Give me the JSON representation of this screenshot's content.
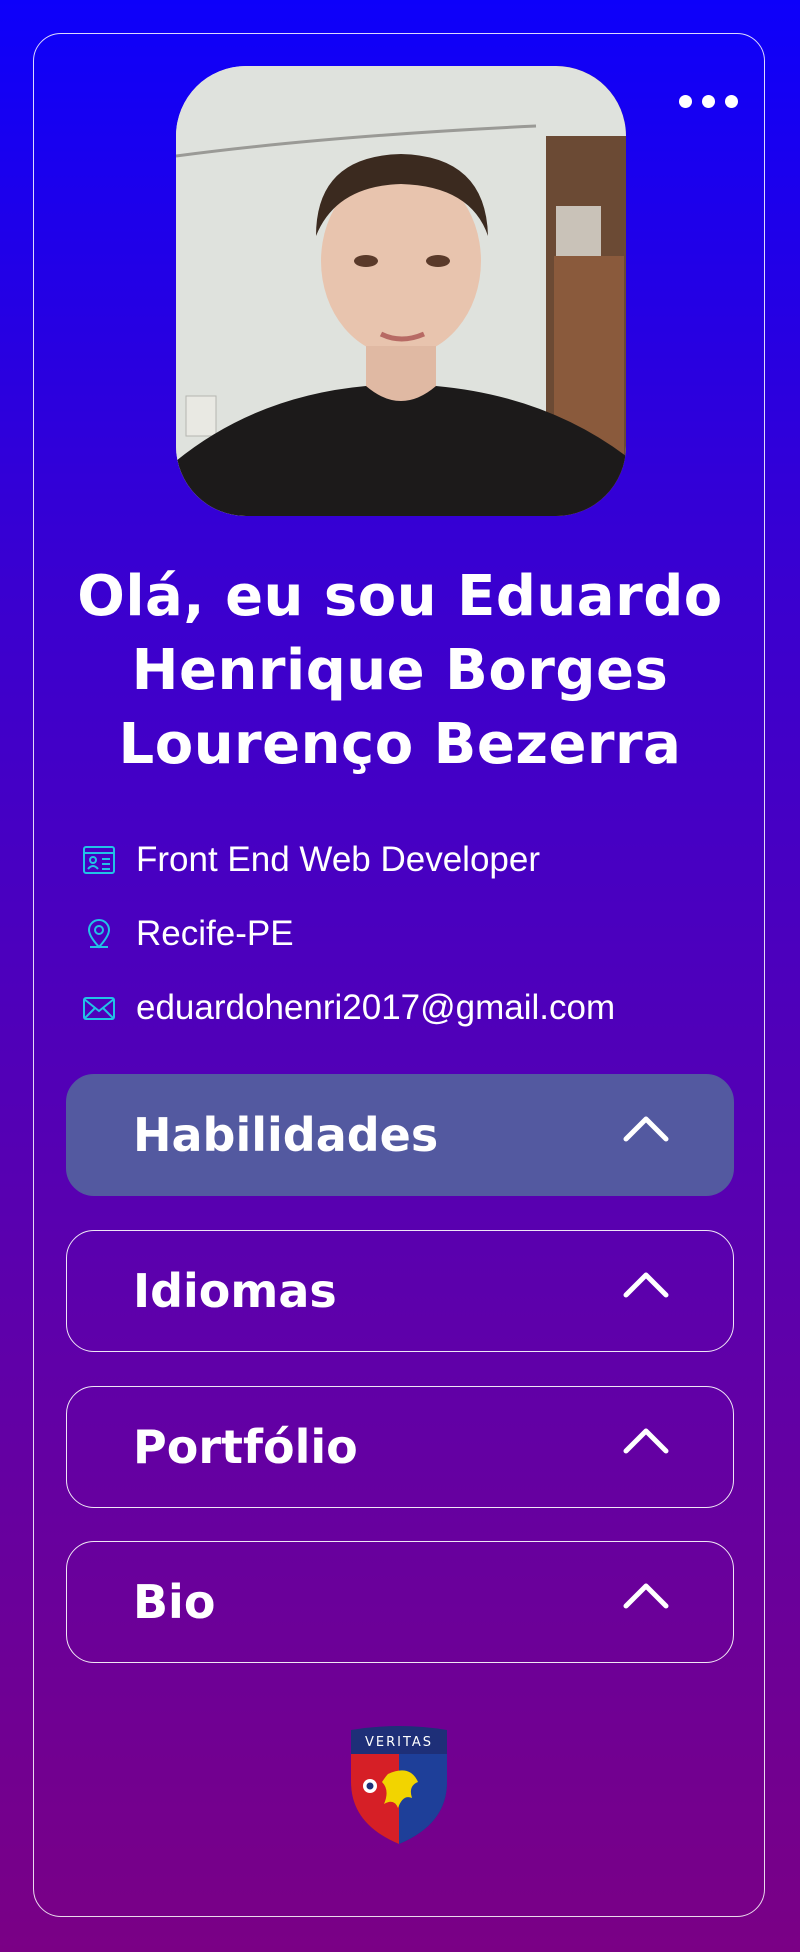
{
  "profile": {
    "greeting": "Olá, eu sou Eduardo Henrique Borges Lourenço Bezerra",
    "role": "Front End Web Developer",
    "location": "Recife-PE",
    "email": "eduardohenri2017@gmail.com"
  },
  "icons": {
    "more": "more-horizontal-icon",
    "role": "id-card-icon",
    "location": "map-pin-icon",
    "email": "mail-icon",
    "chevron": "chevron-up-icon"
  },
  "colors": {
    "background_top": "#0d00fa",
    "background_bottom": "#7a0085",
    "icon_accent": "#22c3e6",
    "active_section": "#5359a0"
  },
  "sections": [
    {
      "label": "Habilidades",
      "active": true
    },
    {
      "label": "Idiomas",
      "active": false
    },
    {
      "label": "Portfólio",
      "active": false
    },
    {
      "label": "Bio",
      "active": false
    }
  ],
  "crest": {
    "motto": "VERITAS"
  }
}
